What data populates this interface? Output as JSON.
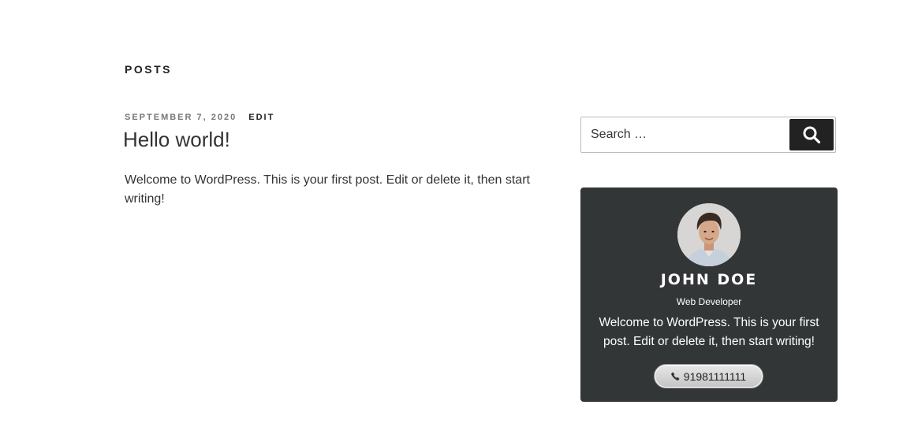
{
  "page": {
    "section_title": "POSTS"
  },
  "post": {
    "date": "SEPTEMBER 7, 2020",
    "edit_label": "EDIT",
    "title": "Hello world!",
    "excerpt": "Welcome to WordPress. This is your first post. Edit or delete it, then start writing!"
  },
  "search": {
    "placeholder": "Search …",
    "icon": "search-icon"
  },
  "profile": {
    "name": "JOHN DOE",
    "role": "Web Developer",
    "bio": "Welcome to WordPress. This is your first post. Edit or delete it, then start writing!",
    "phone": "91981111111",
    "phone_icon": "phone-icon",
    "card_color": "#333636"
  }
}
